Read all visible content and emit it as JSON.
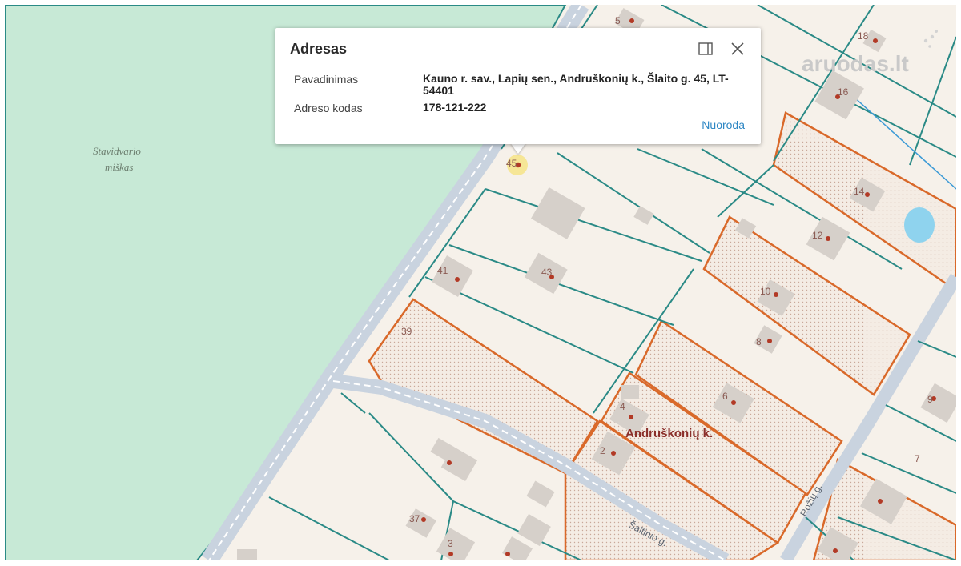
{
  "map": {
    "forest_label": [
      "Stavidvario",
      "miškas"
    ],
    "village_label": "Andruškonių k.",
    "street_saltinio": "Šaltinio g.",
    "street_rozu": "Rožių g.",
    "watermark": "aruodas.lt",
    "house_numbers": [
      "5",
      "18",
      "16",
      "14",
      "12",
      "10",
      "8",
      "6",
      "4",
      "2",
      "45",
      "43",
      "41",
      "39",
      "37",
      "3",
      "7",
      "9"
    ],
    "colors": {
      "forest": "#c7e9d6",
      "land": "#f6f1ea",
      "road": "#c9d3df",
      "parcel_line": "#2a8a86",
      "highlight_line": "#d9692a",
      "building": "#d6d0ca",
      "marker": "#b23a26"
    }
  },
  "popup": {
    "title": "Adresas",
    "rows": [
      {
        "label": "Pavadinimas",
        "value_line1": "Kauno r. sav., Lapių sen., Andruškonių k., Šlaito g. 45, LT-",
        "value_line2": "54401"
      },
      {
        "label": "Adreso kodas",
        "value_line1": "178-121-222"
      }
    ],
    "link": "Nuoroda",
    "icons": {
      "dock": "dock-panel-icon",
      "close": "close-icon"
    }
  }
}
